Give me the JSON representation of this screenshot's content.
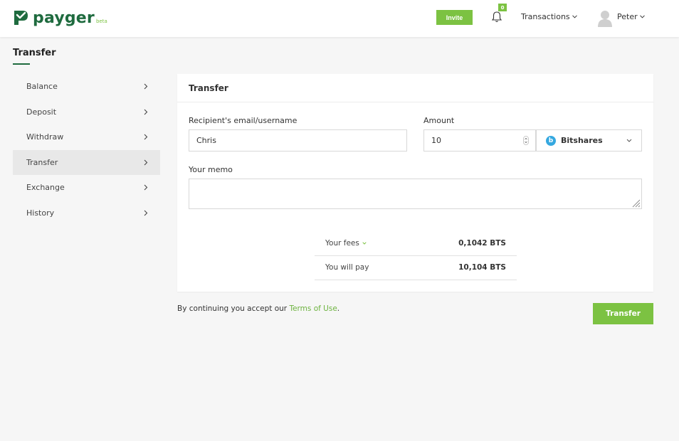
{
  "brand": {
    "name": "payger",
    "tag": "beta"
  },
  "header": {
    "invite_label": "Invite",
    "notifications_count": "0",
    "transactions_label": "Transactions",
    "user_name": "Peter"
  },
  "page": {
    "title": "Transfer"
  },
  "sidebar": {
    "items": [
      {
        "label": "Balance"
      },
      {
        "label": "Deposit"
      },
      {
        "label": "Withdraw"
      },
      {
        "label": "Transfer"
      },
      {
        "label": "Exchange"
      },
      {
        "label": "History"
      }
    ],
    "active": "Transfer"
  },
  "form": {
    "card_title": "Transfer",
    "recipient_label": "Recipient's email/username",
    "recipient_value": "Chris",
    "amount_label": "Amount",
    "amount_value": "10",
    "currency_label": "Bitshares",
    "currency_icon_letter": "b",
    "memo_label": "Your memo",
    "memo_value": ""
  },
  "fees": {
    "fees_label": "Your fees",
    "fees_value": "0,1042 BTS",
    "pay_label": "You will pay",
    "pay_value": "10,104 BTS"
  },
  "footer": {
    "terms_prefix": "By continuing you accept our ",
    "terms_link": "Terms of Use",
    "terms_suffix": ".",
    "submit_label": "Transfer"
  },
  "colors": {
    "brand_green": "#7cc242",
    "dark_green": "#1f6b3f",
    "bitshares_blue": "#35a8e0"
  }
}
